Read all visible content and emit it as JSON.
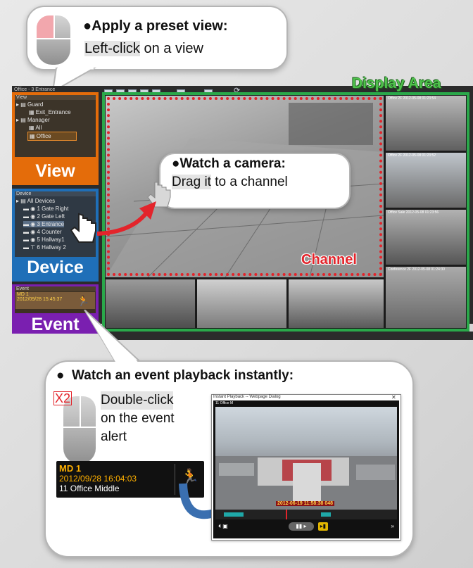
{
  "callout_preset": {
    "bullet": "●",
    "title": "Apply a preset view:",
    "action_highlight": "Left-click",
    "action_rest": " on a view"
  },
  "callout_camera": {
    "bullet": "●",
    "title": "Watch a camera:",
    "action_highlight": "Drag it",
    "action_rest": " to a channel"
  },
  "callout_event": {
    "bullet": "●",
    "title": "Watch an event playback instantly:",
    "x2": "X2",
    "line1": "Double-click",
    "line2": "on the event",
    "line3": "alert",
    "alert": {
      "title": "MD 1",
      "datetime": "2012/09/28 16:04:03",
      "camera": "11 Office Middle"
    },
    "playback_window": {
      "title": "Instant Playback -- Webpage Dialog",
      "cam_label": "11 Office M",
      "overlay_timestamp": "2012-06-19 11:58:38 048"
    }
  },
  "labels": {
    "display_area": "Display Area",
    "channel": "Channel",
    "view": "View",
    "device": "Device",
    "event": "Event"
  },
  "app": {
    "window_title": "Office - 3 Entrance"
  },
  "view_panel": {
    "header": "View",
    "tree": [
      {
        "label": "Guard",
        "level": 0
      },
      {
        "label": "Exit_Entrance",
        "level": 1
      },
      {
        "label": "Manager",
        "level": 0
      },
      {
        "label": "All",
        "level": 1
      },
      {
        "label": "Office",
        "level": 1,
        "selected": true
      }
    ]
  },
  "device_panel": {
    "header": "Device",
    "tree": [
      {
        "label": "All Devices",
        "level": 0
      },
      {
        "label": "1 Gate Right",
        "level": 1
      },
      {
        "label": "2 Gate Left",
        "level": 1
      },
      {
        "label": "3 Entrance",
        "level": 1,
        "selected": true
      },
      {
        "label": "4 Counter",
        "level": 1
      },
      {
        "label": "5 Hallway1",
        "level": 1
      },
      {
        "label": "6 Hallway 2",
        "level": 1
      }
    ]
  },
  "event_panel": {
    "header": "Event",
    "item_title": "MD 1",
    "item_datetime": "2012/09/28 15:45:37"
  },
  "camera_timestamps": {
    "right1": "Office 2F  2012-05-08 01:23:54",
    "right2": "Office 2F  2012-05-08 01:23:52",
    "right3": "Office Sale  2012-05-08 01:23:56",
    "right4": "Conference 2F  2012-05-08 01:24:30"
  },
  "colors": {
    "display_green": "#2aa84a",
    "channel_red": "#e3242b",
    "view_orange": "#e46c0a",
    "device_blue": "#1f6fb8",
    "event_purple": "#7a1fb0"
  }
}
